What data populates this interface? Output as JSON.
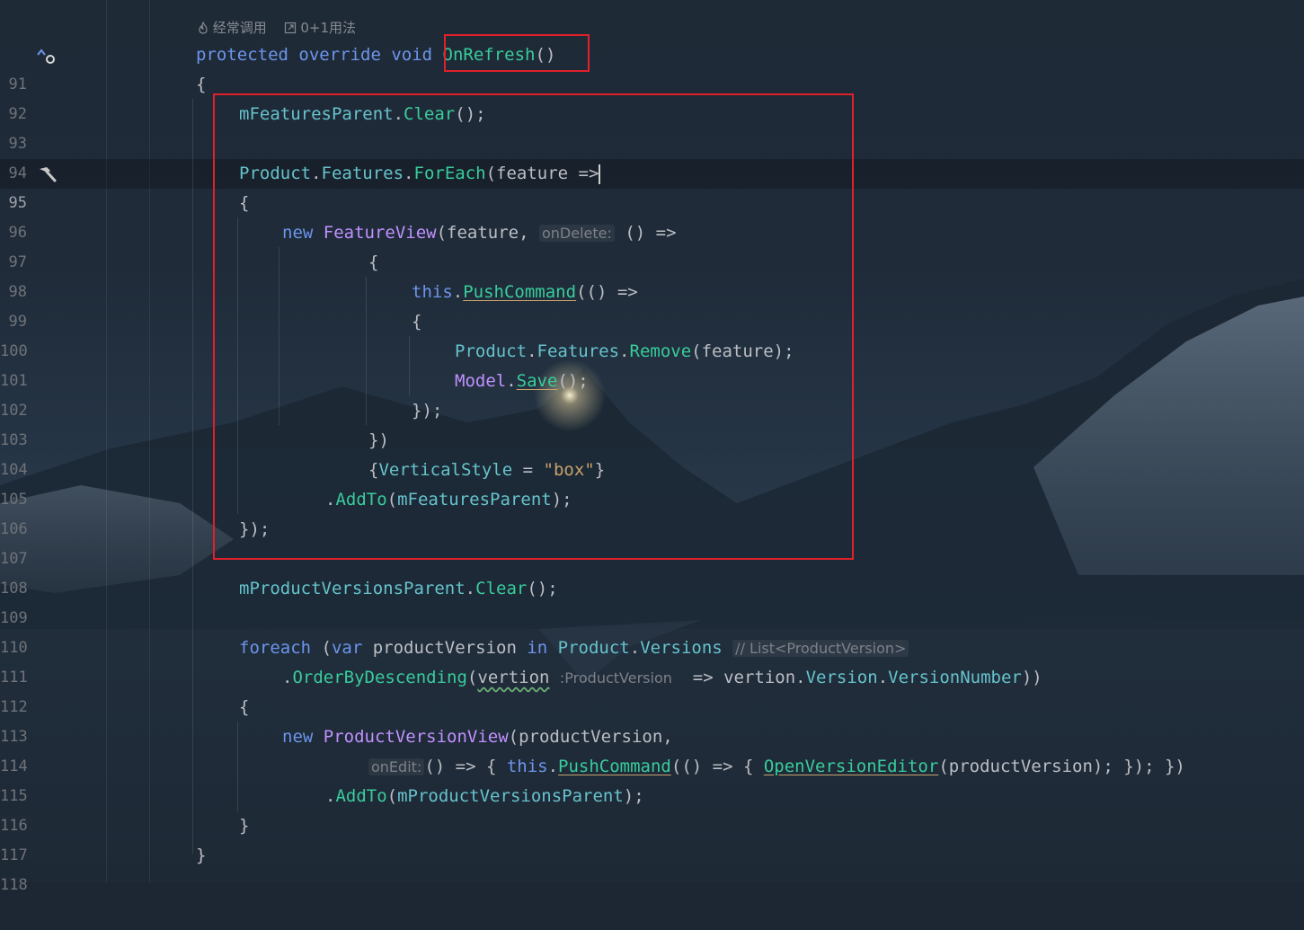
{
  "editor": {
    "code_vision": {
      "usage_icon": "flame-icon",
      "usage_label": "经常调用",
      "implementations_icon": "external-link-icon",
      "implementations_label": "0+1用法"
    },
    "current_line": 95,
    "gutter_icons": {
      "line_91": "override-method-icon",
      "line_95": "hammer-icon"
    },
    "hints": {
      "onDelete": "onDelete:",
      "list_type": "// List<ProductVersion>",
      "vertion_type": ":ProductVersion",
      "onEdit": "onEdit:"
    },
    "lines": [
      {
        "n": "91"
      },
      {
        "n": "92"
      },
      {
        "n": "93"
      },
      {
        "n": "94"
      },
      {
        "n": "95"
      },
      {
        "n": "96"
      },
      {
        "n": "97"
      },
      {
        "n": "98"
      },
      {
        "n": "99"
      },
      {
        "n": "100"
      },
      {
        "n": "101"
      },
      {
        "n": "102"
      },
      {
        "n": "103"
      },
      {
        "n": "104"
      },
      {
        "n": "105"
      },
      {
        "n": "106"
      },
      {
        "n": "107"
      },
      {
        "n": "108"
      },
      {
        "n": "109"
      },
      {
        "n": "110"
      },
      {
        "n": "111"
      },
      {
        "n": "112"
      },
      {
        "n": "113"
      },
      {
        "n": "114"
      },
      {
        "n": "115"
      },
      {
        "n": "116"
      },
      {
        "n": "117"
      },
      {
        "n": "118"
      }
    ]
  },
  "colors": {
    "keyword": "#6c95eb",
    "type": "#c191ff",
    "field": "#66c3cc",
    "method": "#39cc9b",
    "string": "#c9a26d",
    "highlight_box": "#e0202a"
  }
}
